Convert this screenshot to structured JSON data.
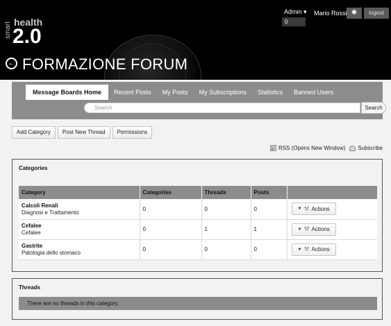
{
  "header": {
    "logo_smart": "smart",
    "logo_health": "health",
    "logo_version": "2.0",
    "back_icon": "arrow-left-circle-icon",
    "page_title": "FORMAZIONE FORUM"
  },
  "topbar": {
    "admin_label": "Admin",
    "admin_count": "0",
    "user_name": "Mario Rossi",
    "pin_icon": "pin-icon",
    "logout_label": "logout"
  },
  "nav": {
    "tabs": [
      {
        "label": "Message Boards Home",
        "active": true
      },
      {
        "label": "Recent Posts"
      },
      {
        "label": "My Posts"
      },
      {
        "label": "My Subscriptions"
      },
      {
        "label": "Statistics"
      },
      {
        "label": "Banned Users"
      }
    ],
    "search_placeholder": "Search",
    "search_button": "Search"
  },
  "actions": {
    "add_category": "Add Category",
    "post_new_thread": "Post New Thread",
    "permissions": "Permissions"
  },
  "feeds": {
    "rss_label": "RSS (Opens New Window)",
    "subscribe_label": "Subscribe"
  },
  "categories": {
    "title": "Categories",
    "headers": [
      "Category",
      "Categories",
      "Threads",
      "Posts",
      ""
    ],
    "rows": [
      {
        "name": "Calcoli Renali",
        "desc": "Diagnosi e Trattamento",
        "categories": "0",
        "threads": "0",
        "posts": "0",
        "action": "Actions"
      },
      {
        "name": "Cefalee",
        "desc": "Cefalee",
        "categories": "0",
        "threads": "1",
        "posts": "1",
        "action": "Actions"
      },
      {
        "name": "Gastrite",
        "desc": "Patologia dello stomaco",
        "categories": "0",
        "threads": "0",
        "posts": "0",
        "action": "Actions"
      }
    ]
  },
  "threads": {
    "title": "Threads",
    "empty_message": "There are no threads in this category."
  },
  "colors": {
    "header_bg": "#000000",
    "nav_bg": "#8c8c8c",
    "page_bg": "#f2f2f2"
  }
}
